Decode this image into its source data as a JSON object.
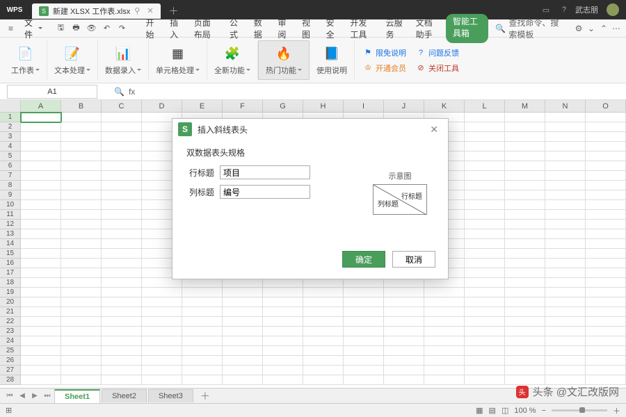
{
  "app": {
    "name": "WPS",
    "username": "武志朋"
  },
  "file_tab": {
    "name": "新建 XLSX 工作表.xlsx"
  },
  "menu": {
    "file_label": "文件",
    "tabs": [
      "开始",
      "插入",
      "页面布局",
      "公式",
      "数据",
      "审阅",
      "视图",
      "安全",
      "开发工具",
      "云服务",
      "文档助手",
      "智能工具箱"
    ],
    "search_placeholder": "查找命令、搜索模板"
  },
  "ribbon": {
    "groups": [
      {
        "label": "工作表",
        "icon": "📄",
        "dd": true
      },
      {
        "label": "文本处理",
        "icon": "📝",
        "dd": true
      },
      {
        "label": "数据录入",
        "icon": "📊",
        "dd": true
      },
      {
        "label": "单元格处理",
        "icon": "▦",
        "dd": true
      },
      {
        "label": "全新功能",
        "icon": "🧩",
        "dd": true
      },
      {
        "label": "热门功能",
        "icon": "🔥",
        "dd": true,
        "hot": true
      },
      {
        "label": "使用说明",
        "icon": "📘",
        "dd": false
      }
    ],
    "links": {
      "limit": "限免说明",
      "feedback": "问题反馈",
      "member": "开通会员",
      "close": "关闭工具"
    }
  },
  "fbar": {
    "cell": "A1",
    "fx": "fx"
  },
  "cols": [
    "A",
    "B",
    "C",
    "D",
    "E",
    "F",
    "G",
    "H",
    "I",
    "J",
    "K",
    "L",
    "M",
    "N",
    "O"
  ],
  "dialog": {
    "title": "插入斜线表头",
    "section": "双数据表头规格",
    "row_label": "行标题",
    "row_value": "项目",
    "col_label": "列标题",
    "col_value": "编号",
    "preview": "示意图",
    "preview_row": "行标题",
    "preview_col": "列标题",
    "ok": "确定",
    "cancel": "取消"
  },
  "sheets": [
    "Sheet1",
    "Sheet2",
    "Sheet3"
  ],
  "status": {
    "zoom": "100 %"
  },
  "watermark": "头条 @文汇改版网"
}
